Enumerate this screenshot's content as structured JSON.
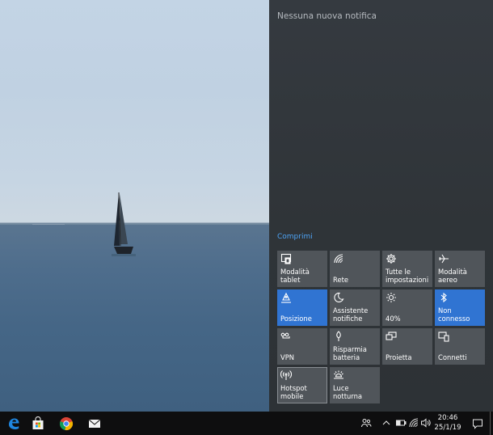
{
  "wallpaper": {
    "description_icon": "sailboat-icon"
  },
  "action_center": {
    "no_notifications": "Nessuna nuova notifica",
    "collapse": "Comprimi",
    "accent_color": "#3074d2",
    "tiles": [
      {
        "label": "Modalità tablet",
        "icon": "tablet-mode-icon",
        "active": false
      },
      {
        "label": "Rete",
        "icon": "network-icon",
        "active": false
      },
      {
        "label": "Tutte le\nimpostazioni",
        "icon": "gear-icon",
        "active": false
      },
      {
        "label": "Modalità aereo",
        "icon": "airplane-icon",
        "active": false
      },
      {
        "label": "Posizione",
        "icon": "location-icon",
        "active": true
      },
      {
        "label": "Assistente\nnotifiche",
        "icon": "moon-icon",
        "active": false
      },
      {
        "label": "40%",
        "icon": "brightness-icon",
        "active": false
      },
      {
        "label": "Non connesso",
        "icon": "bluetooth-icon",
        "active": true
      },
      {
        "label": "VPN",
        "icon": "vpn-icon",
        "active": false
      },
      {
        "label": "Risparmia\nbatteria",
        "icon": "battery-saver-icon",
        "active": false
      },
      {
        "label": "Proietta",
        "icon": "project-icon",
        "active": false
      },
      {
        "label": "Connetti",
        "icon": "connect-icon",
        "active": false
      },
      {
        "label": "Hotspot mobile",
        "icon": "hotspot-icon",
        "active": false
      },
      {
        "label": "Luce notturna",
        "icon": "night-light-icon",
        "active": false
      }
    ]
  },
  "taskbar": {
    "apps": [
      {
        "name": "edge-icon"
      },
      {
        "name": "store-icon"
      },
      {
        "name": "chrome-icon"
      },
      {
        "name": "mail-icon"
      }
    ],
    "clock": {
      "time": "20:46",
      "date": "25/1/19"
    }
  }
}
